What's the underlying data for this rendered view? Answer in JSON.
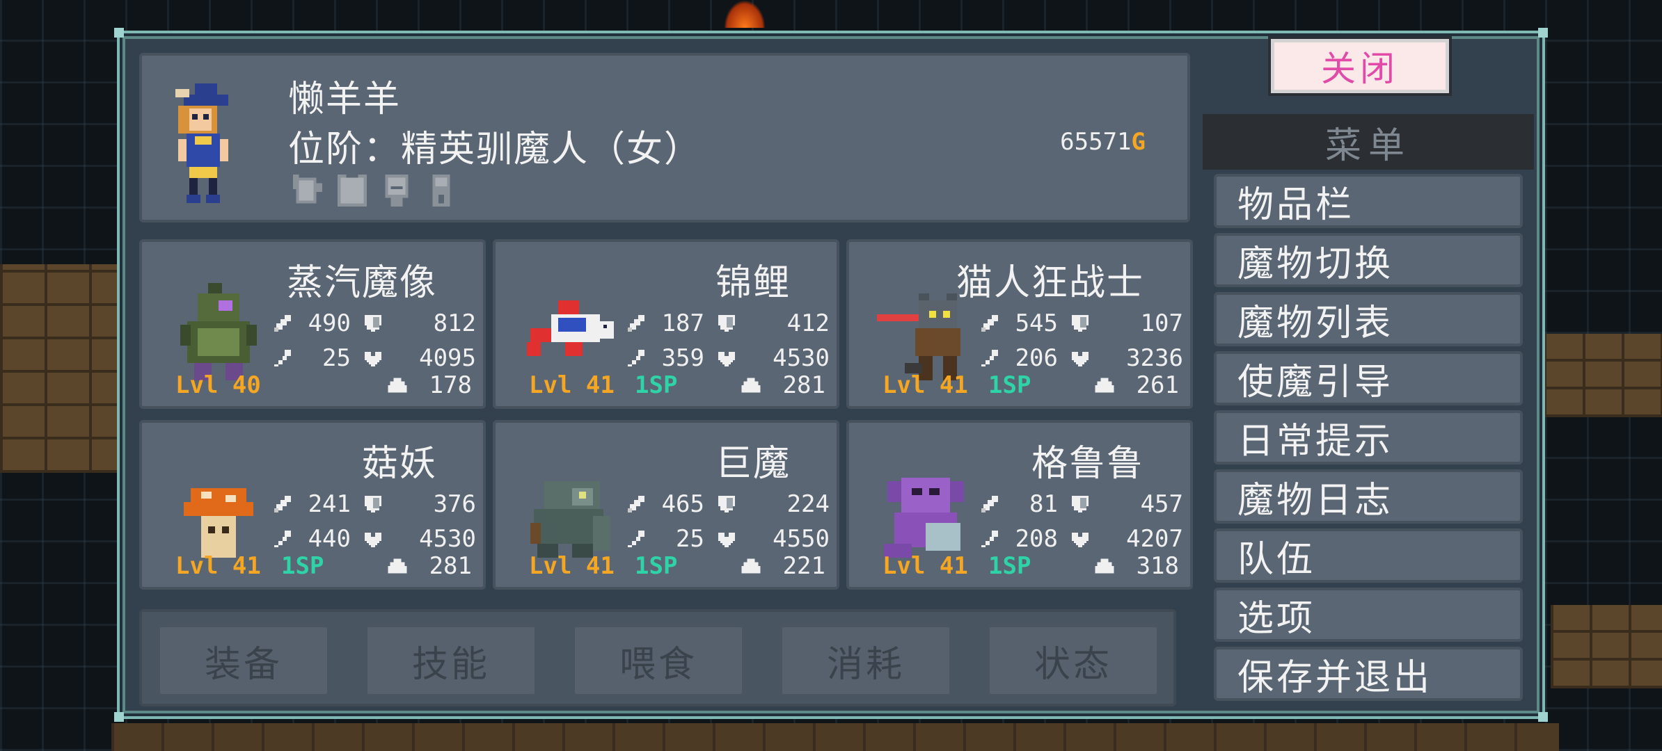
{
  "player": {
    "name": "懒羊羊",
    "rank": "位阶：精英驯魔人（女）",
    "gold_amount": "65571",
    "gold_symbol": "G",
    "equipment_slots": [
      "glove-icon",
      "armor-icon",
      "helmet-icon",
      "ring-icon"
    ]
  },
  "monsters": [
    {
      "name": "蒸汽魔像",
      "attack": "490",
      "defense": "812",
      "magic": "25",
      "hp": "4095",
      "level": "Lvl 40",
      "sp": "",
      "food": "178"
    },
    {
      "name": "锦鲤",
      "attack": "187",
      "defense": "412",
      "magic": "359",
      "hp": "4530",
      "level": "Lvl 41",
      "sp": "1SP",
      "food": "281"
    },
    {
      "name": "猫人狂战士",
      "attack": "545",
      "defense": "107",
      "magic": "206",
      "hp": "3236",
      "level": "Lvl 41",
      "sp": "1SP",
      "food": "261"
    },
    {
      "name": "菇妖",
      "attack": "241",
      "defense": "376",
      "magic": "440",
      "hp": "4530",
      "level": "Lvl 41",
      "sp": "1SP",
      "food": "281"
    },
    {
      "name": "巨魔",
      "attack": "465",
      "defense": "224",
      "magic": "25",
      "hp": "4550",
      "level": "Lvl 41",
      "sp": "1SP",
      "food": "221"
    },
    {
      "name": "格鲁鲁",
      "attack": "81",
      "defense": "457",
      "magic": "208",
      "hp": "4207",
      "level": "Lvl 41",
      "sp": "1SP",
      "food": "318"
    }
  ],
  "actions": [
    "装备",
    "技能",
    "喂食",
    "消耗",
    "状态"
  ],
  "menu": {
    "close_label": "关闭",
    "title": "菜单",
    "items": [
      "物品栏",
      "魔物切换",
      "魔物列表",
      "使魔引导",
      "日常提示",
      "魔物日志",
      "队伍",
      "选项",
      "保存并退出"
    ]
  },
  "colors": {
    "level": "#f5a623",
    "sp": "#2fd3a8",
    "gold": "#f5a623",
    "close_text": "#e24aa8",
    "panel_border": "#7fb7b3"
  }
}
